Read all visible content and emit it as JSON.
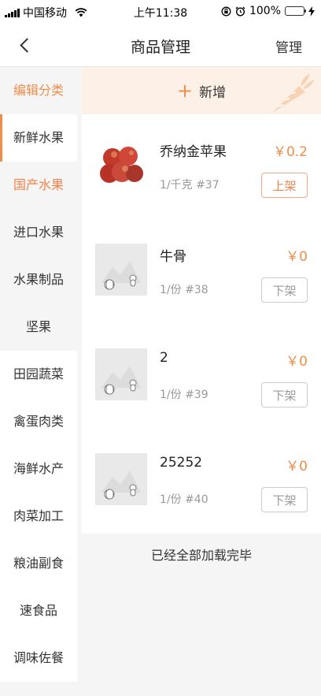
{
  "status_bar": {
    "carrier": "中国移动",
    "time": "上午11:38",
    "battery": "100%"
  },
  "nav": {
    "title": "商品管理",
    "right_label": "管理"
  },
  "sidebar": {
    "edit_label": "编辑分类",
    "items": [
      {
        "label": "新鲜水果"
      },
      {
        "label": "国产水果"
      },
      {
        "label": "进口水果"
      },
      {
        "label": "水果制品"
      },
      {
        "label": "坚果"
      },
      {
        "label": "田园蔬菜"
      },
      {
        "label": "禽蛋肉类"
      },
      {
        "label": "海鲜水产"
      },
      {
        "label": "肉菜加工"
      },
      {
        "label": "粮油副食"
      },
      {
        "label": "速食品"
      },
      {
        "label": "调味佐餐"
      }
    ]
  },
  "add_bar": {
    "label": "新增"
  },
  "products": [
    {
      "name": "乔纳金苹果",
      "meta": "1/千克  #37",
      "price": "￥0.2",
      "button": "上架",
      "image": "apple-photo"
    },
    {
      "name": "牛骨",
      "meta": "1/份  #38",
      "price": "￥0",
      "button": "下架",
      "image": "placeholder-image"
    },
    {
      "name": "2",
      "meta": "1/份  #39",
      "price": "￥0",
      "button": "下架",
      "image": "placeholder-image"
    },
    {
      "name": "25252",
      "meta": "1/份  #40",
      "price": "￥0",
      "button": "下架",
      "image": "placeholder-image"
    }
  ],
  "footer": {
    "text": "已经全部加载完毕"
  },
  "colors": {
    "accent": "#f08d49",
    "add_bar_bg": "#fdf1e7",
    "battery_green": "#4cd964"
  }
}
